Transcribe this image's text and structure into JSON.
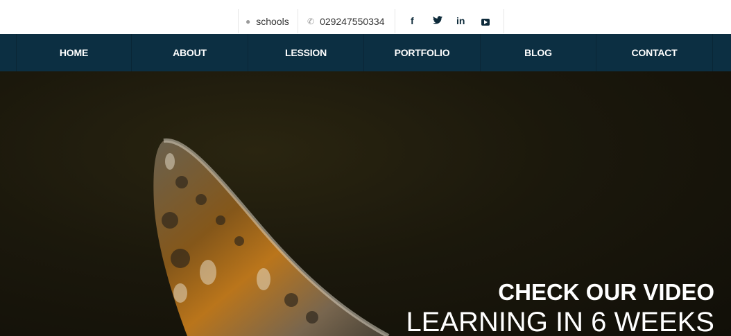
{
  "topbar": {
    "skype_label": "schools",
    "skype_icon": "skype-icon",
    "phone": "029247550334",
    "phone_icon": "phone-icon",
    "social": [
      "facebook-icon",
      "twitter-icon",
      "linkedin-icon",
      "youtube-icon"
    ]
  },
  "nav": {
    "items": [
      {
        "label": "HOME"
      },
      {
        "label": "ABOUT"
      },
      {
        "label": "LESSION"
      },
      {
        "label": "PORTFOLIO"
      },
      {
        "label": "BLOG"
      },
      {
        "label": "CONTACT"
      }
    ]
  },
  "hero": {
    "title": "CHECK OUR VIDEO",
    "subtitle": "LEARNING IN 6 WEEKS"
  },
  "colors": {
    "nav_bg": "#0c2f42",
    "hero_bg": "#1b180c",
    "icon_dark": "#0d2a3a"
  }
}
